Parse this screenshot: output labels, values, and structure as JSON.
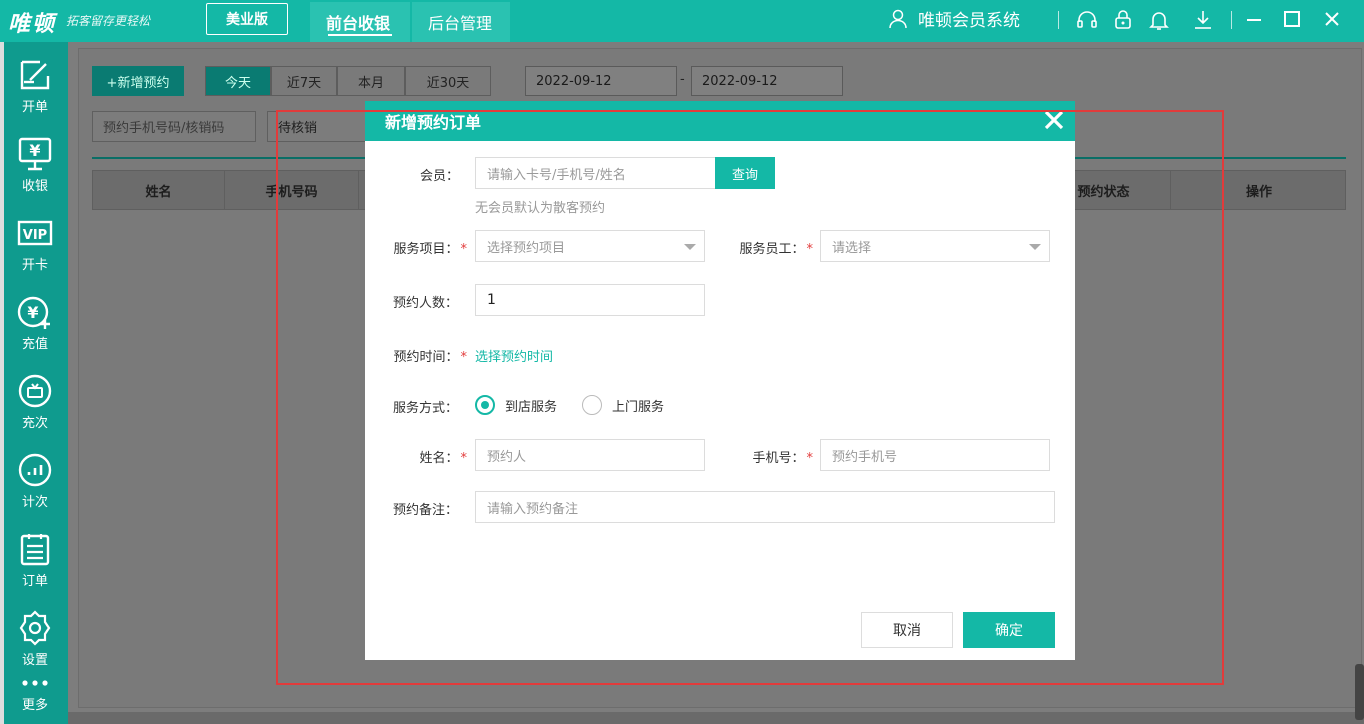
{
  "app": {
    "logo": "唯顿",
    "slogan": "拓客留存更轻松",
    "edition": "美业版",
    "nav_tabs": [
      "前台收银",
      "后台管理"
    ],
    "system_name": "唯顿会员系统",
    "accent_color": "#14b8a6"
  },
  "sidebar": {
    "items": [
      {
        "label": "开单",
        "icon": "edit-icon"
      },
      {
        "label": "收银",
        "icon": "cash-register-icon"
      },
      {
        "label": "开卡",
        "icon": "vip-card-icon"
      },
      {
        "label": "充值",
        "icon": "recharge-icon"
      },
      {
        "label": "充次",
        "icon": "times-card-icon"
      },
      {
        "label": "计次",
        "icon": "chart-icon"
      },
      {
        "label": "订单",
        "icon": "order-list-icon"
      },
      {
        "label": "设置",
        "icon": "gear-icon"
      },
      {
        "label": "更多",
        "icon": "more-icon"
      }
    ]
  },
  "toolbar": {
    "add_label": "+新增预约",
    "ranges": [
      "今天",
      "近7天",
      "本月",
      "近30天"
    ],
    "active_range": "今天",
    "date_from": "2022-09-12",
    "date_sep": "-",
    "date_to": "2022-09-12",
    "search_placeholder": "预约手机号码/核销码",
    "status_value": "待核销"
  },
  "table": {
    "columns": [
      "姓名",
      "手机号码",
      "预约状态",
      "操作"
    ]
  },
  "modal": {
    "title": "新增预约订单",
    "member_label": "会员：",
    "member_placeholder": "请输入卡号/手机号/姓名",
    "query_label": "查询",
    "member_hint": "无会员默认为散客预约",
    "service_item_label": "服务项目：",
    "service_item_placeholder": "选择预约项目",
    "staff_label": "服务员工：",
    "staff_placeholder": "请选择",
    "people_label": "预约人数：",
    "people_value": "1",
    "time_label": "预约时间：",
    "time_link": "选择预约时间",
    "mode_label": "服务方式：",
    "mode_options": [
      "到店服务",
      "上门服务"
    ],
    "mode_selected": "到店服务",
    "name_label": "姓名：",
    "name_placeholder": "预约人",
    "phone_label": "手机号：",
    "phone_placeholder": "预约手机号",
    "remark_label": "预约备注：",
    "remark_placeholder": "请输入预约备注",
    "cancel_label": "取消",
    "ok_label": "确定",
    "required_mark": "*"
  }
}
